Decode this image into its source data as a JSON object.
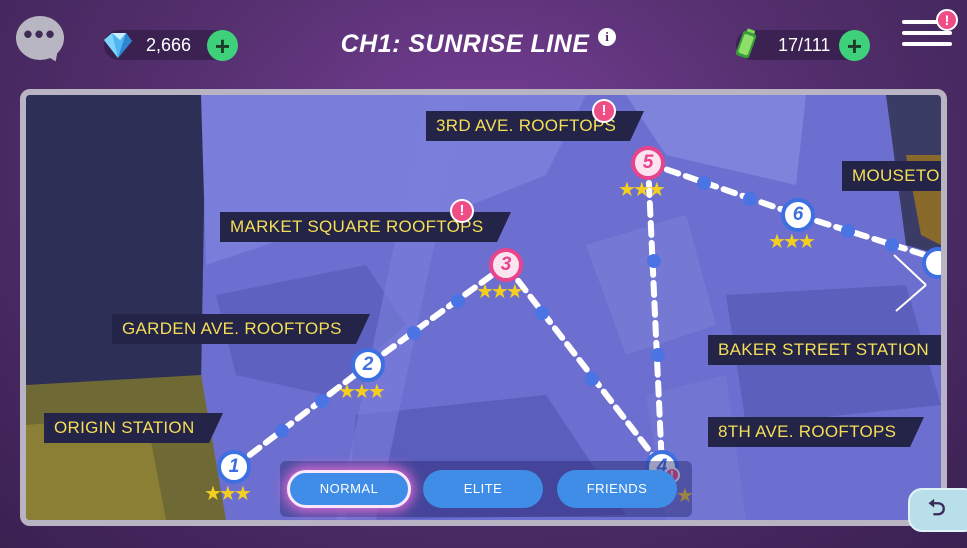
{
  "header": {
    "chat_icon": "chat-bubble-icon",
    "gems": "2,666",
    "chapter_title": "CH1: SUNRISE LINE",
    "info": "i",
    "energy": "17/111",
    "plus": "+",
    "menu_badge": "!"
  },
  "map": {
    "locations": [
      {
        "name": "ORIGIN STATION"
      },
      {
        "name": "GARDEN AVE. ROOFTOPS"
      },
      {
        "name": "MARKET SQUARE ROOFTOPS",
        "alert": "!"
      },
      {
        "name": "3RD AVE. ROOFTOPS",
        "alert": "!"
      },
      {
        "name": "MOUSETON"
      },
      {
        "name": "BAKER STREET STATION"
      },
      {
        "name": "8TH AVE. ROOFTOPS"
      }
    ],
    "nodes": [
      {
        "num": "1",
        "stars": 3
      },
      {
        "num": "2",
        "stars": 3
      },
      {
        "num": "3",
        "stars": 3
      },
      {
        "num": "4",
        "stars": 1,
        "alert": "!"
      },
      {
        "num": "5",
        "stars": 3
      },
      {
        "num": "6",
        "stars": 3
      }
    ]
  },
  "modes": {
    "normal": "NORMAL",
    "elite": "ELITE",
    "friends": "FRIENDS",
    "selected": "NORMAL"
  },
  "colors": {
    "label_text": "#f5df57",
    "label_bg": "#232447",
    "star": "#f4cf1f",
    "node_border": "#3d6fe0",
    "current_node": "#e8448e",
    "badge": "#ee4d86",
    "plus_button": "#3ed07a"
  },
  "back_icon": "return-arrow-icon"
}
